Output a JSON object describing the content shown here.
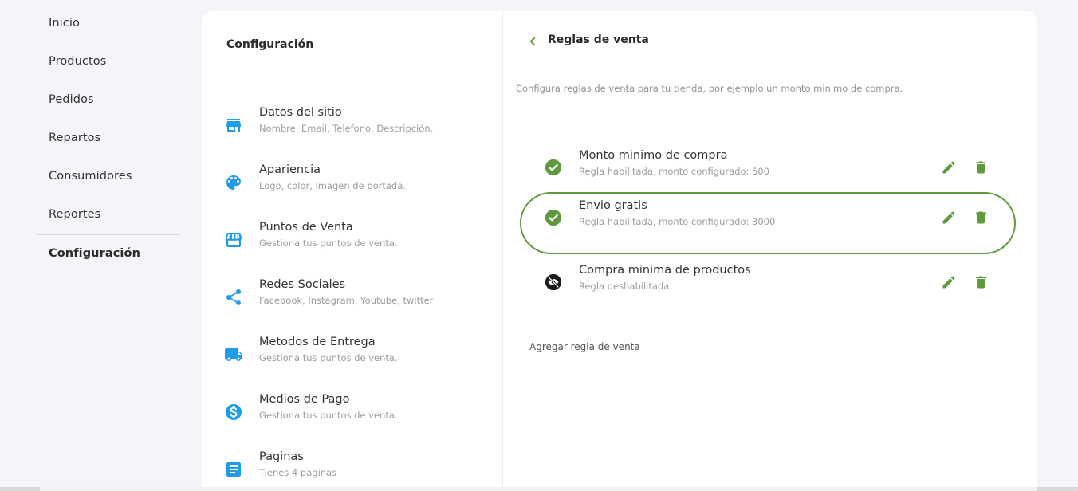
{
  "sidebar": {
    "items": [
      {
        "label": "Inicio"
      },
      {
        "label": "Productos"
      },
      {
        "label": "Pedidos"
      },
      {
        "label": "Repartos"
      },
      {
        "label": "Consumidores"
      },
      {
        "label": "Reportes"
      }
    ],
    "active_label": "Configuración"
  },
  "config": {
    "title": "Configuración",
    "items": [
      {
        "title": "Datos del sitio",
        "subtitle": "Nombre, Email, Telefono, Descripción.",
        "icon": "store-icon"
      },
      {
        "title": "Apariencia",
        "subtitle": "Logo, color, imagen de portada.",
        "icon": "palette-icon"
      },
      {
        "title": "Puntos de Venta",
        "subtitle": "Gestiona tus puntos de venta.",
        "icon": "storefront-icon"
      },
      {
        "title": "Redes Sociales",
        "subtitle": "Facebook, Instagram, Youtube, twitter",
        "icon": "share-icon"
      },
      {
        "title": "Metodos de Entrega",
        "subtitle": "Gestiona tus puntos de venta.",
        "icon": "truck-icon"
      },
      {
        "title": "Medios de Pago",
        "subtitle": "Gestiona tus puntos de venta.",
        "icon": "dollar-circle-icon"
      },
      {
        "title": "Paginas",
        "subtitle": "Tienes 4 paginas",
        "icon": "document-icon"
      }
    ]
  },
  "rules": {
    "title": "Reglas de venta",
    "description": "Configura reglas de venta para tu tienda, por ejemplo un monto minimo de compra.",
    "items": [
      {
        "title": "Monto minimo de compra",
        "subtitle": "Regla habilitada, monto configurado: 500",
        "status": "enabled"
      },
      {
        "title": "Envio gratis",
        "subtitle": "Regla habilitada, monto configurado: 3000",
        "status": "enabled"
      },
      {
        "title": "Compra minima de productos",
        "subtitle": "Regla deshabilitada",
        "status": "disabled"
      }
    ],
    "add_label": "Agregar regla de venta"
  },
  "colors": {
    "accent_green": "#5e9a3c",
    "icon_blue": "#1e9be9",
    "page_bg": "#f4f5f8"
  }
}
